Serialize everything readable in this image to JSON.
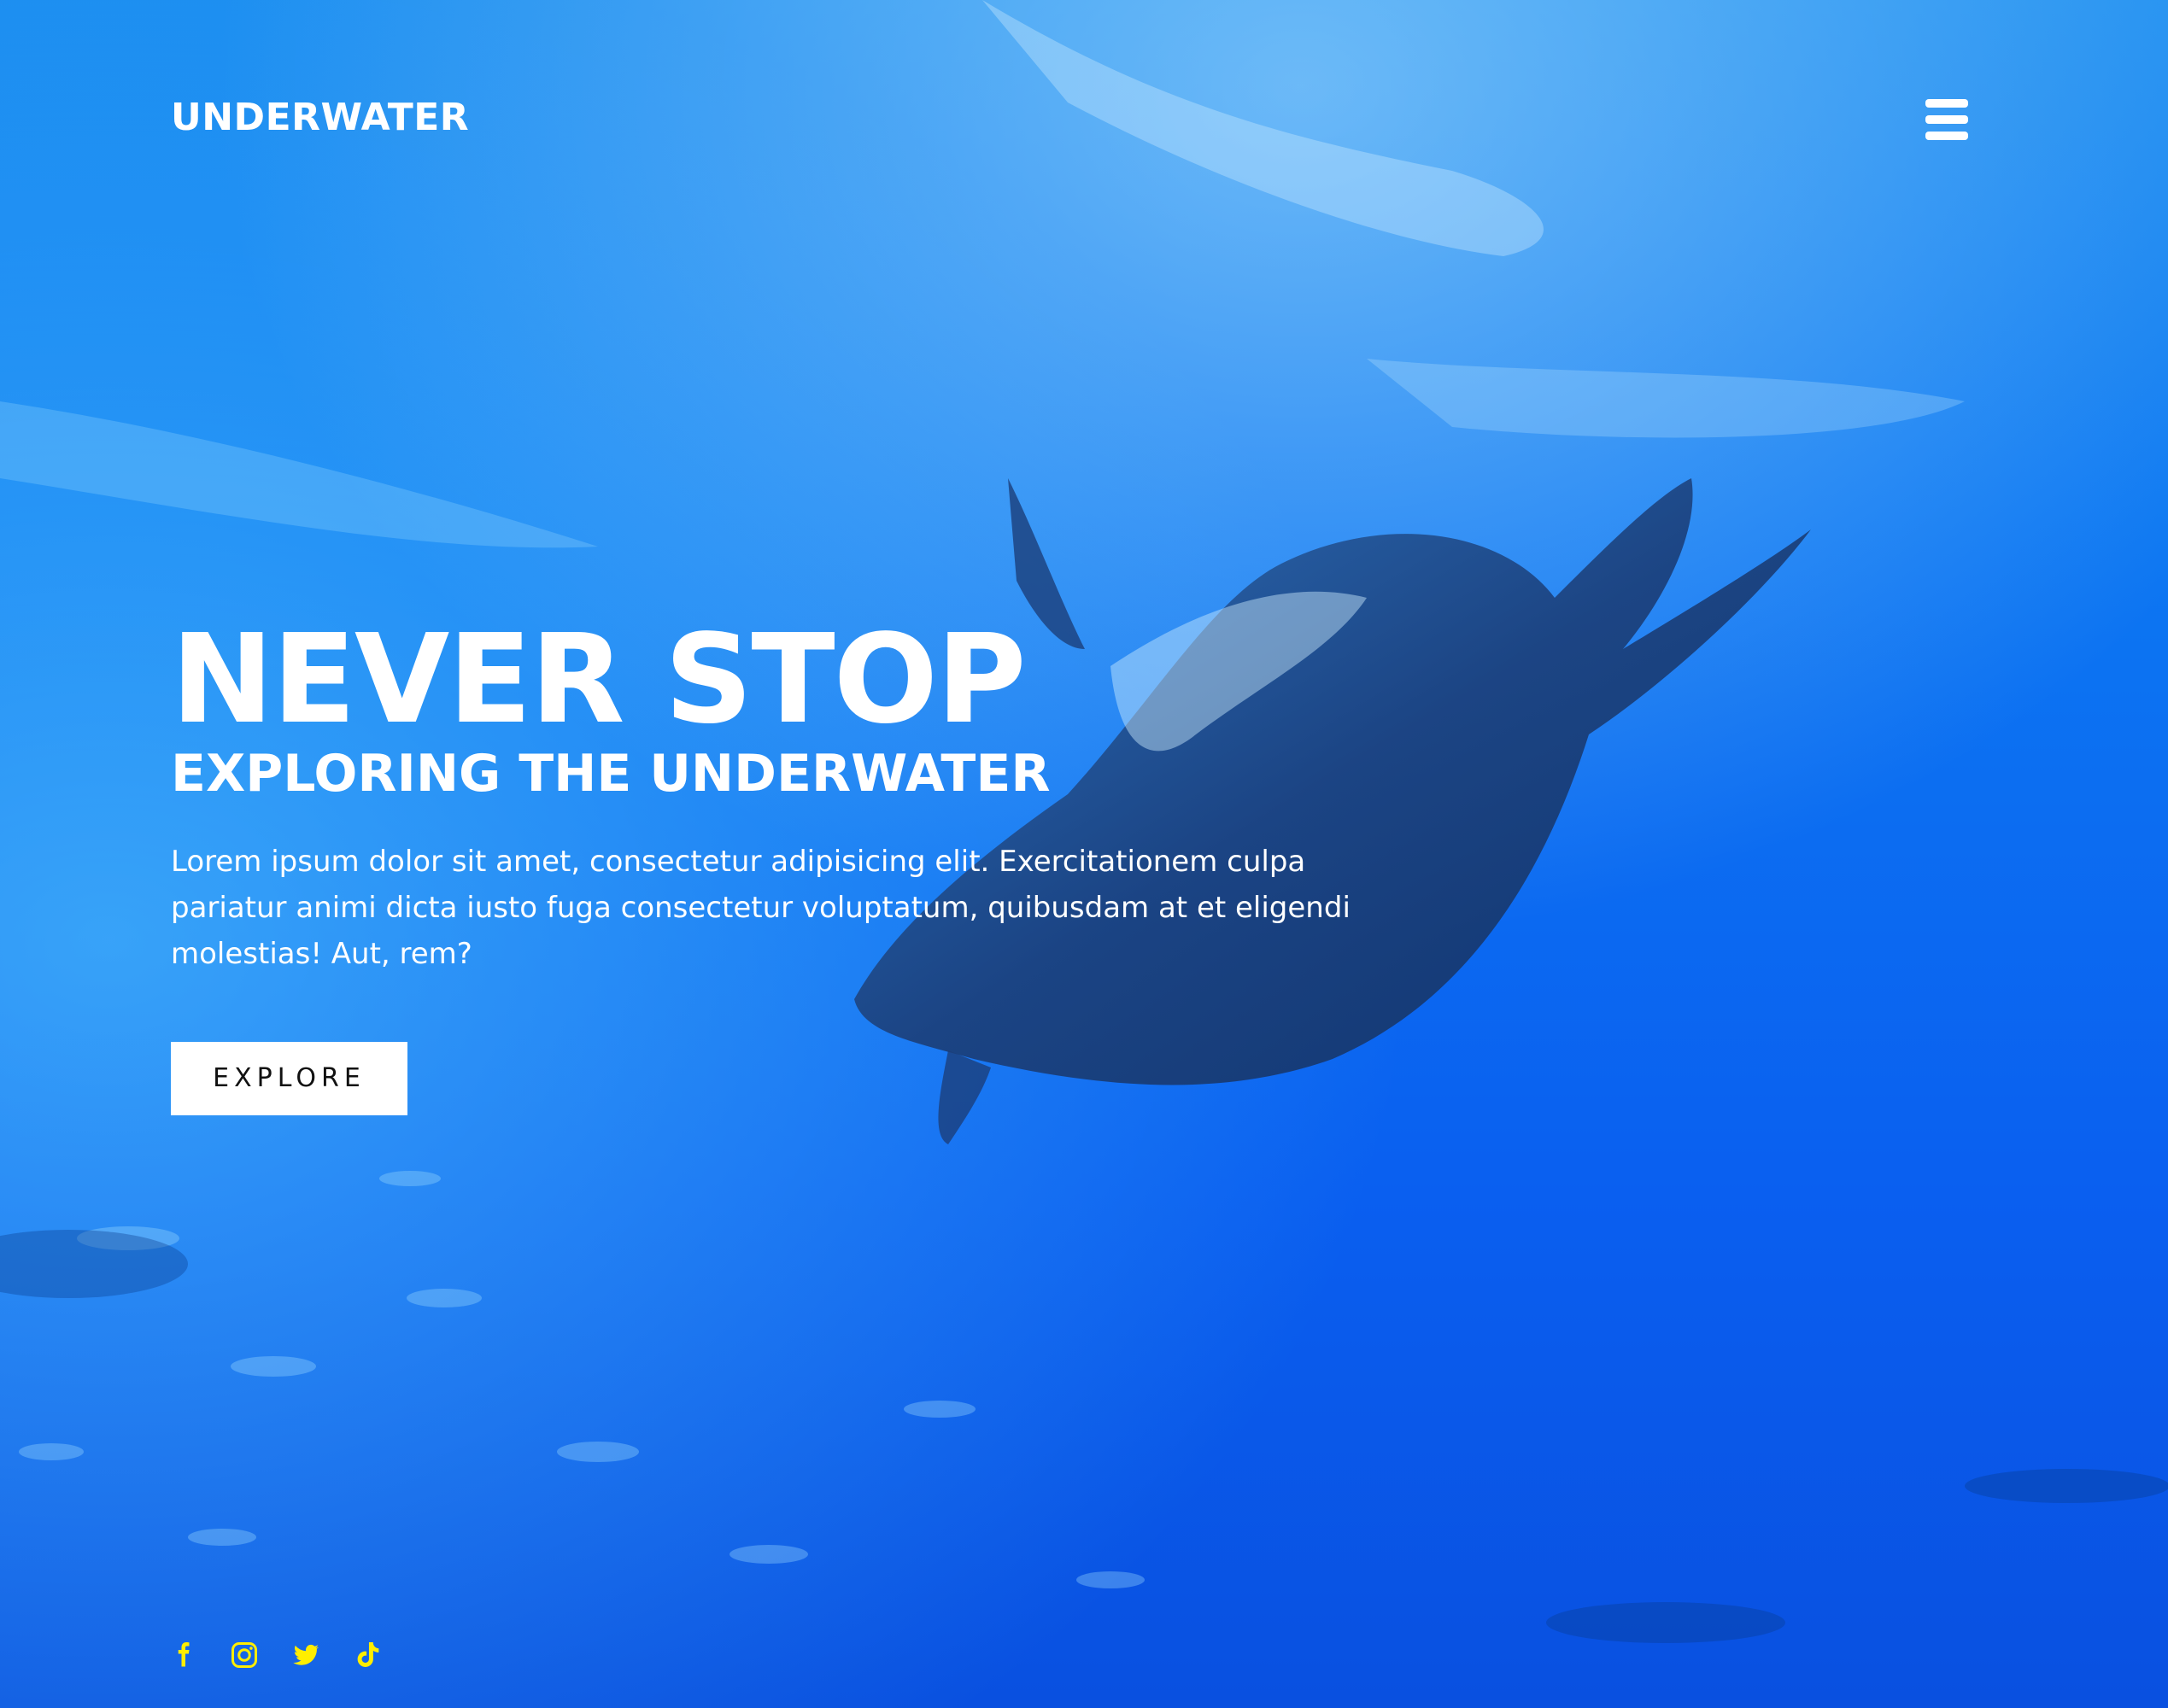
{
  "header": {
    "brand": "UNDERWATER",
    "menu_icon": "hamburger-menu-icon"
  },
  "hero": {
    "title": "NEVER STOP",
    "subtitle": "EXPLORING THE UNDERWATER",
    "description": "Lorem ipsum dolor sit amet, consectetur adipisicing elit. Exercitationem culpa pariatur animi dicta iusto fuga consectetur voluptatum, quibusdam at et eligendi molestias! Aut, rem?",
    "cta_label": "EXPLORE"
  },
  "social": {
    "icons": [
      "facebook-icon",
      "instagram-icon",
      "twitter-icon",
      "tiktok-icon"
    ],
    "color": "#ffee00"
  },
  "colors": {
    "background": "#0b66ee",
    "text": "#ffffff",
    "button_bg": "#ffffff",
    "button_text": "#111111",
    "social_icon": "#ffee00"
  }
}
